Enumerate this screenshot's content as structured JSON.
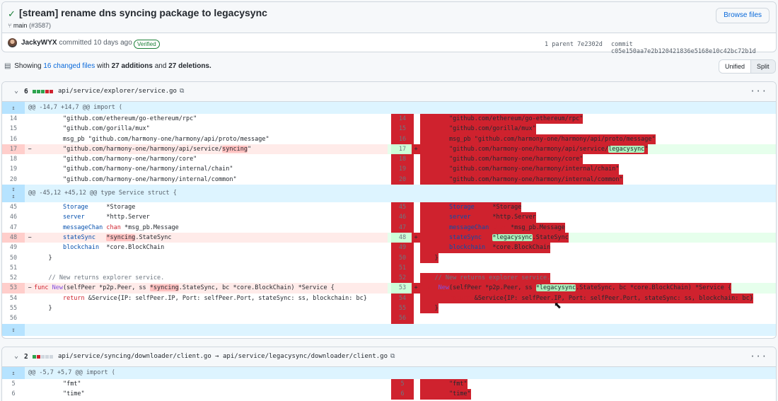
{
  "commit": {
    "title": "[stream] rename dns syncing package to legacysync",
    "branch": "main",
    "pr": "(#3587)",
    "browse_files": "Browse files",
    "author": "JackyWYX",
    "committed": "committed 10 days ago",
    "verified": "Verified",
    "parent_label": "1 parent",
    "parent_sha": "7e2302d",
    "commit_label": "commit",
    "commit_sha": "c05e150aa7e2b120421836e5168e10c42bc72b1d"
  },
  "summary": {
    "prefix": "Showing",
    "changed": "16 changed files",
    "with": "with",
    "additions": "27 additions",
    "and": "and",
    "deletions": "27 deletions."
  },
  "view_toggle": {
    "unified": "Unified",
    "split": "Split"
  },
  "files": [
    {
      "count": "6",
      "path": "api/service/explorer/service.go",
      "hunk1": "@@ -14,7 +14,7 @@ import (",
      "hunk2": "@@ -45,12 +45,12 @@ type Service struct {"
    },
    {
      "count": "2",
      "path": "api/service/syncing/downloader/client.go → api/service/legacysync/downloader/client.go",
      "hunk1": "@@ -5,7 +5,7 @@ import ("
    }
  ],
  "lines": {
    "l14": "\"github.com/ethereum/go-ethereum/rpc\"",
    "l15": "\"github.com/gorilla/mux\"",
    "l16": "msg_pb \"github.com/harmony-one/harmony/api/proto/message\"",
    "l17a": "\"github.com/harmony-one/harmony/api/service/",
    "l17old": "syncing",
    "l17new": "legacysync",
    "l17b": "\"",
    "l18": "\"github.com/harmony-one/harmony/core\"",
    "l19": "\"github.com/harmony-one/harmony/internal/chain\"",
    "l20": "\"github.com/harmony-one/harmony/internal/common\"",
    "l45a": "Storage",
    "l45b": "*Storage",
    "l46a": "server",
    "l46b": "*http.Server",
    "l47a": "messageChan",
    "l47k": "chan",
    "l47b": "*msg_pb.Message",
    "l48a": "stateSync",
    "l48old": "*syncing",
    "l48new": "*legacysync",
    "l48b": ".StateSync",
    "l49a": "blockchain",
    "l49b": "*core.BlockChain",
    "brace": "}",
    "comment": "// New returns explorer service.",
    "func_kw": "func",
    "func_name": "New",
    "f_a": "(selfPeer *p2p.Peer, ss ",
    "f_old": "*syncing",
    "f_new": "*legacysync",
    "f_b": ".StateSync, bc *core.BlockChain) *Service {",
    "ret_kw": "return",
    "ret": " &Service{IP: selfPeer.IP, Port: selfPeer.Port, stateSync: ss, blockchain: bc}",
    "fmt": "\"fmt\"",
    "time": "\"time\""
  },
  "line_numbers": {
    "h1": [
      "14",
      "15",
      "16",
      "17",
      "18",
      "19",
      "20"
    ],
    "h2": [
      "45",
      "46",
      "47",
      "48",
      "49",
      "50",
      "51",
      "52",
      "53",
      "54",
      "55",
      "56"
    ],
    "h3": [
      "5",
      "6"
    ]
  },
  "markers": {
    "minus": "−",
    "plus": "+"
  },
  "colors": {
    "added": "#2da44e",
    "deleted": "#cf222e",
    "link": "#0969da"
  }
}
